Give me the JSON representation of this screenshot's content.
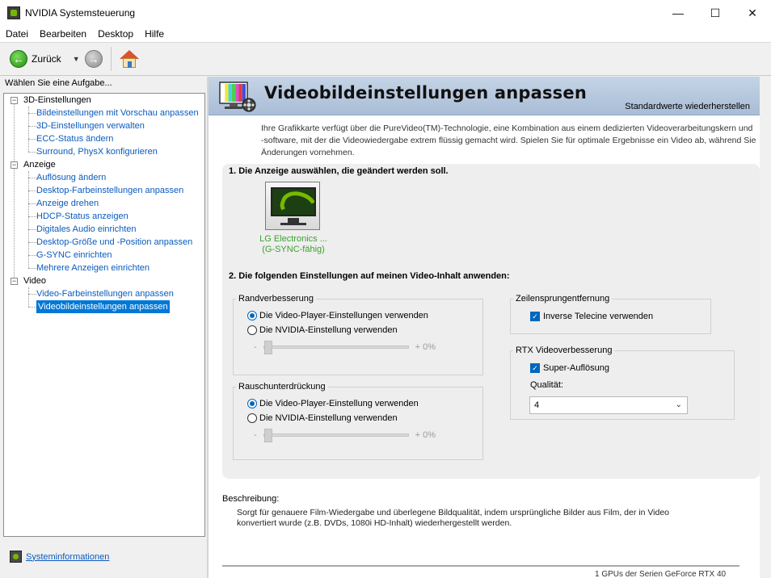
{
  "window": {
    "title": "NVIDIA Systemsteuerung",
    "controls": {
      "minimize": "—",
      "maximize": "☐",
      "close": "✕"
    }
  },
  "menu": [
    "Datei",
    "Bearbeiten",
    "Desktop",
    "Hilfe"
  ],
  "toolbar": {
    "back_label": "Zurück"
  },
  "tasks": {
    "header": "Wählen Sie eine Aufgabe...",
    "categories": [
      {
        "label": "3D-Einstellungen",
        "items": [
          "Bildeinstellungen mit Vorschau anpassen",
          "3D-Einstellungen verwalten",
          "ECC-Status ändern",
          "Surround, PhysX konfigurieren"
        ]
      },
      {
        "label": "Anzeige",
        "items": [
          "Auflösung ändern",
          "Desktop-Farbeinstellungen anpassen",
          "Anzeige drehen",
          "HDCP-Status anzeigen",
          "Digitales Audio einrichten",
          "Desktop-Größe und -Position anpassen",
          "G-SYNC einrichten",
          "Mehrere Anzeigen einrichten"
        ]
      },
      {
        "label": "Video",
        "items": [
          "Video-Farbeinstellungen anpassen",
          "Videobildeinstellungen anpassen"
        ]
      }
    ],
    "system_info": "Systeminformationen"
  },
  "page": {
    "title": "Videobildeinstellungen anpassen",
    "restore": "Standardwerte wiederherstellen",
    "intro_line1": "Ihre Grafikkarte verfügt über die PureVideo(TM)-Technologie, eine Kombination aus einem dedizierten Videoverarbeitungskern und",
    "intro_line2": "-software, mit der die Videowiedergabe extrem flüssig gemacht wird. Spielen Sie für optimale Ergebnisse ein Video ab, während Sie",
    "intro_line3": "Änderungen vornehmen.",
    "section1": "1. Die Anzeige auswählen, die geändert werden soll.",
    "display_name": "LG Electronics ...",
    "display_sub": "(G-SYNC-fähig)",
    "section2": "2. Die folgenden Einstellungen auf meinen Video-Inhalt anwenden:",
    "edge": {
      "title": "Randverbesserung",
      "opt1": "Die Video-Player-Einstellungen verwenden",
      "opt2": "Die NVIDIA-Einstellung verwenden",
      "minus": "-",
      "plus": "+ 0%",
      "level": 0
    },
    "noise": {
      "title": "Rauschunterdrückung",
      "opt1": "Die Video-Player-Einstellung verwenden",
      "opt2": "Die NVIDIA-Einstellung verwenden",
      "minus": "-",
      "plus": "+ 0%",
      "level": 0
    },
    "deinterlace": {
      "title": "Zeilensprungentfernung",
      "opt1": "Inverse Telecine verwenden"
    },
    "rtx": {
      "title": "RTX Videoverbesserung",
      "opt1": "Super-Auflösung",
      "quality_label": "Qualität:",
      "quality_value": "4"
    },
    "description_title": "Beschreibung:",
    "description_line1": "Sorgt für genauere Film-Wiedergabe und überlegene Bildqualität, indem ursprüngliche Bilder aus Film, der in Video",
    "description_line2": "konvertiert wurde (z.B. DVDs, 1080i HD-Inhalt) wiederhergestellt werden."
  },
  "taskbar_hint": "1 GPUs der Serien GeForce RTX 40",
  "colors": {
    "accent": "#0067c0",
    "link": "#0a5bbf",
    "nvidia_green": "#76b900",
    "header_bg": "#b6c8de"
  }
}
